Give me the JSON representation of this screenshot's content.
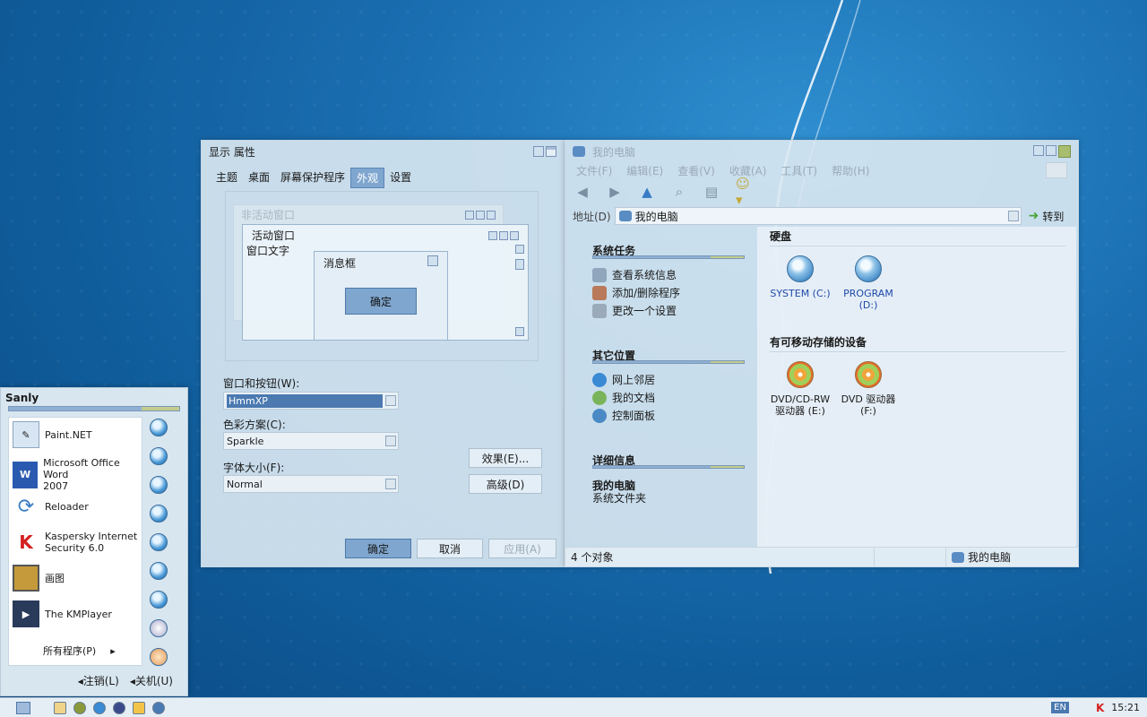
{
  "display_props": {
    "title": "显示 属性",
    "tabs": [
      "主题",
      "桌面",
      "屏幕保护程序",
      "外观",
      "设置"
    ],
    "active_tab": "外观",
    "preview": {
      "inactive_title": "非活动窗口",
      "active_title": "活动窗口",
      "window_text": "窗口文字",
      "msgbox_title": "消息框",
      "msgbox_ok": "确定"
    },
    "windows_buttons_label": "窗口和按钮(W):",
    "windows_buttons_value": "HmmXP",
    "color_scheme_label": "色彩方案(C):",
    "color_scheme_value": "Sparkle",
    "font_size_label": "字体大小(F):",
    "font_size_value": "Normal",
    "effects_button": "效果(E)...",
    "advanced_button": "高级(D)",
    "ok_button": "确定",
    "cancel_button": "取消",
    "apply_button": "应用(A)"
  },
  "my_computer": {
    "title": "我的电脑",
    "menu": [
      "文件(F)",
      "编辑(E)",
      "查看(V)",
      "收藏(A)",
      "工具(T)",
      "帮助(H)"
    ],
    "toolbar_icons": [
      "back-arrow",
      "forward-arrow",
      "up-arrow",
      "search",
      "folders",
      "views"
    ],
    "address_label": "地址(D)",
    "address_value": "我的电脑",
    "go_button": "转到",
    "system_tasks": {
      "heading": "系统任务",
      "items": [
        "查看系统信息",
        "添加/删除程序",
        "更改一个设置"
      ]
    },
    "other_places": {
      "heading": "其它位置",
      "items": [
        "网上邻居",
        "我的文档",
        "控制面板"
      ]
    },
    "details": {
      "heading": "详细信息",
      "name": "我的电脑",
      "desc": "系统文件夹"
    },
    "hdd_group": "硬盘",
    "drives": [
      {
        "line1": "SYSTEM (C:)",
        "line2": ""
      },
      {
        "line1": "PROGRAM",
        "line2": "(D:)"
      }
    ],
    "removable_group": "有可移动存储的设备",
    "removables": [
      {
        "line1": "DVD/CD-RW",
        "line2": "驱动器 (E:)"
      },
      {
        "line1": "DVD 驱动器",
        "line2": "(F:)"
      }
    ],
    "status_count": "4 个对象",
    "status_location": "我的电脑"
  },
  "start_menu": {
    "user": "Sanly",
    "programs": [
      {
        "line1": "Paint.NET",
        "line2": ""
      },
      {
        "line1": "Microsoft Office Word",
        "line2": "2007"
      },
      {
        "line1": "Reloader",
        "line2": ""
      },
      {
        "line1": "Kaspersky Internet",
        "line2": "Security 6.0"
      },
      {
        "line1": "画图",
        "line2": ""
      },
      {
        "line1": "The KMPlayer",
        "line2": ""
      }
    ],
    "all_programs": "所有程序(P)",
    "logoff": "注销(L)",
    "shutdown": "关机(U)"
  },
  "taskbar": {
    "lang": "EN",
    "clock": "15:21"
  }
}
